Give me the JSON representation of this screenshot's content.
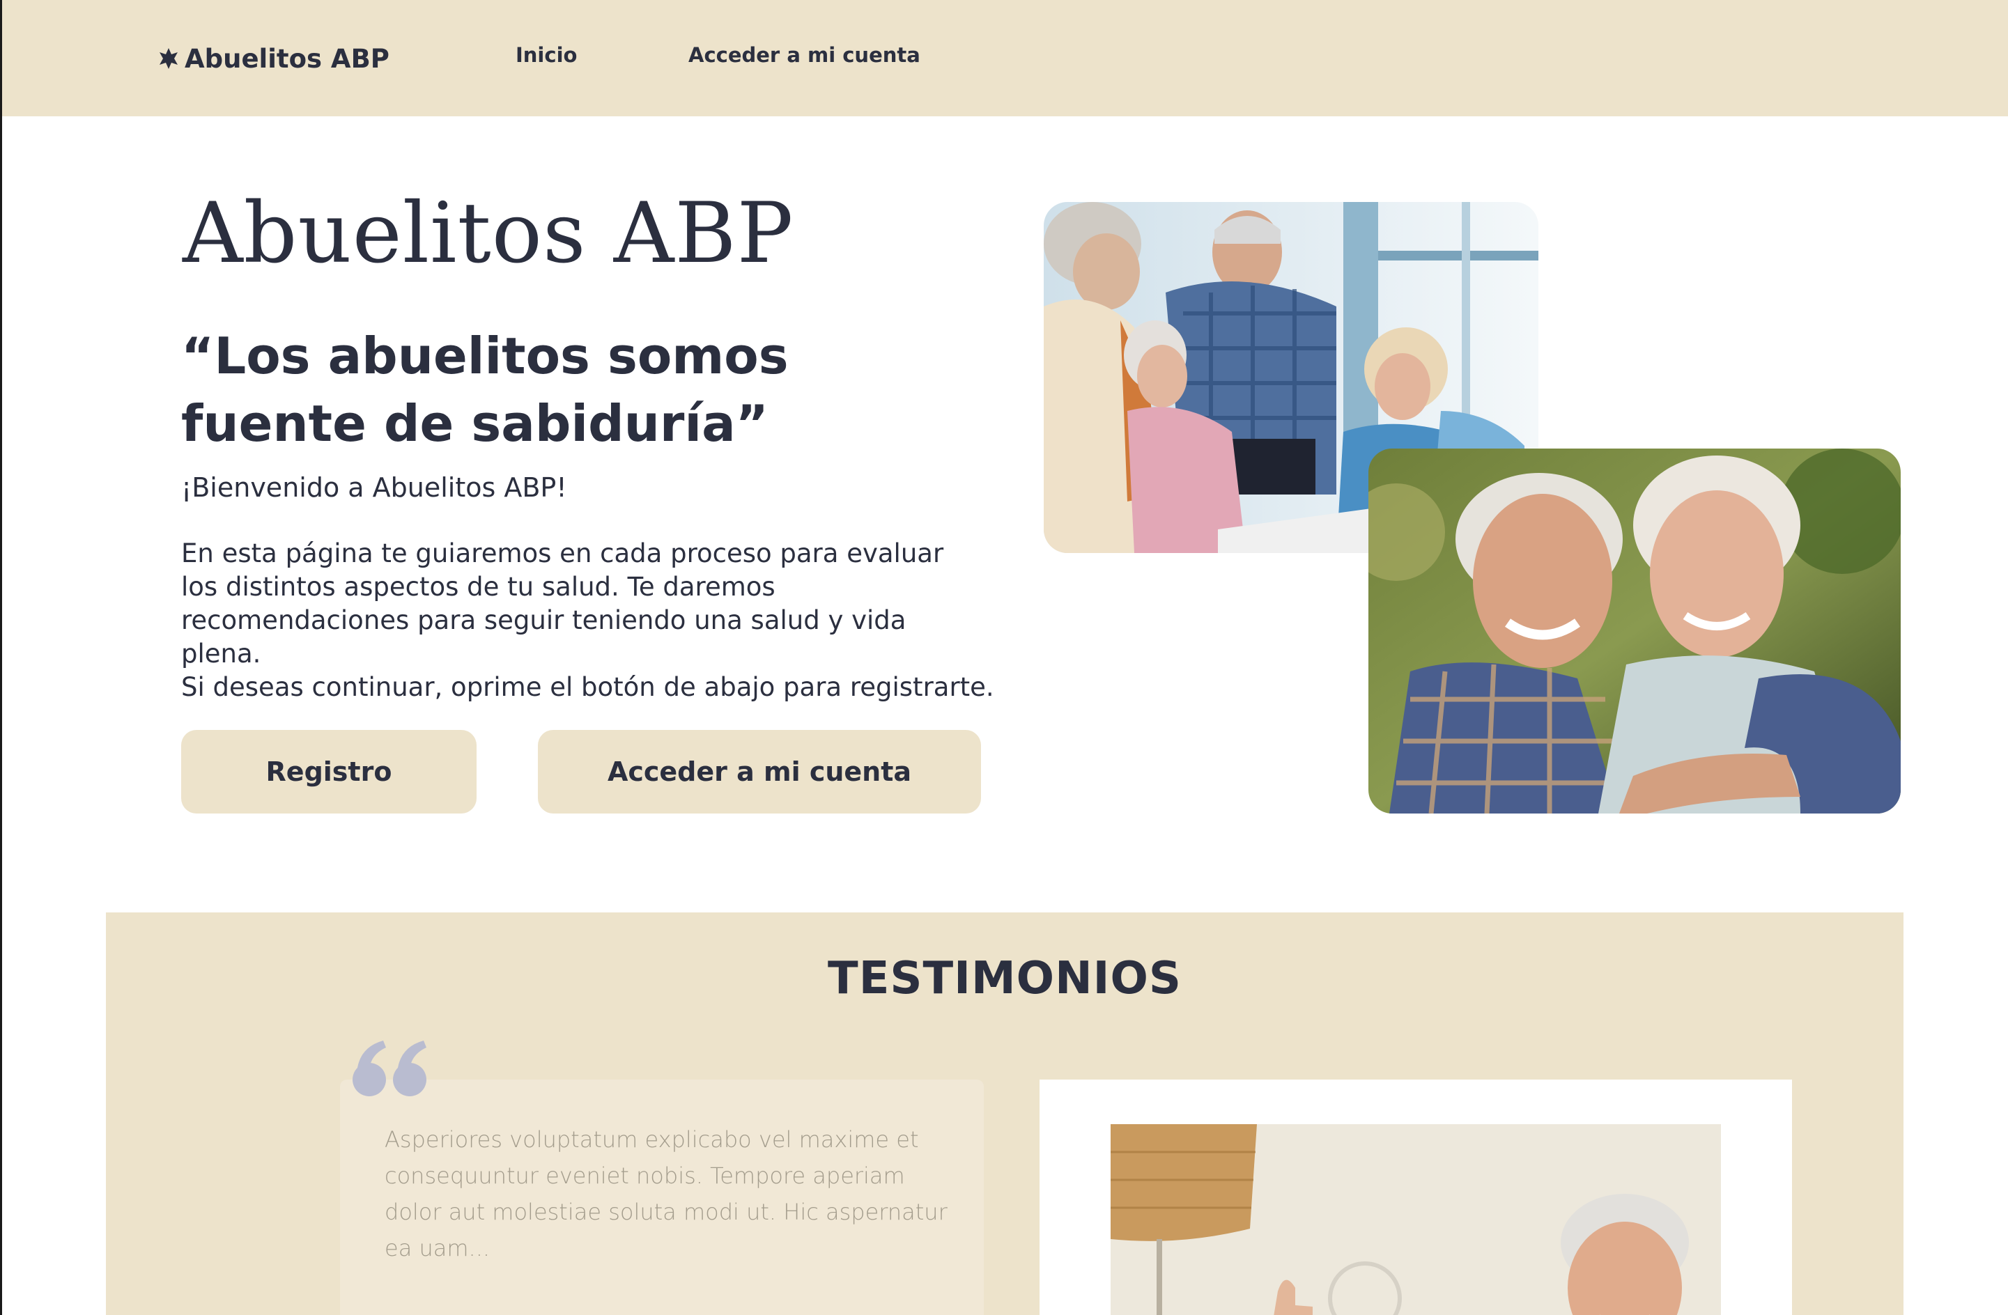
{
  "nav": {
    "brand": "Abuelitos ABP",
    "brand_icon": "asterisk-icon",
    "links": [
      "Inicio",
      "Acceder a mi cuenta"
    ]
  },
  "hero": {
    "title": "Abuelitos ABP",
    "quote": "“Los abuelitos somos fuente de sabiduría”",
    "welcome": "¡Bienvenido a Abuelitos ABP!",
    "paragraph": "En esta página te guiaremos en cada proceso para evaluar los distintos aspectos de tu salud. Te daremos recomendaciones para seguir teniendo una salud y vida plena.",
    "cta_text": "Si deseas continuar, oprime el botón de abajo para registrarte.",
    "buttons": {
      "register": "Registro",
      "account": "Acceder a mi cuenta"
    }
  },
  "testimonials": {
    "title": "TESTIMONIOS",
    "quote": "Asperiores voluptatum explicabo vel maxime et consequuntur eveniet nobis. Tempore aperiam dolor aut molestiae soluta modi ut. Hic aspernatur ea uam..."
  },
  "colors": {
    "accent_beige": "#ede3cb",
    "text_dark": "#2b2f3f",
    "quote_mark": "#b9bcd0",
    "muted_text": "#a39c8c"
  }
}
